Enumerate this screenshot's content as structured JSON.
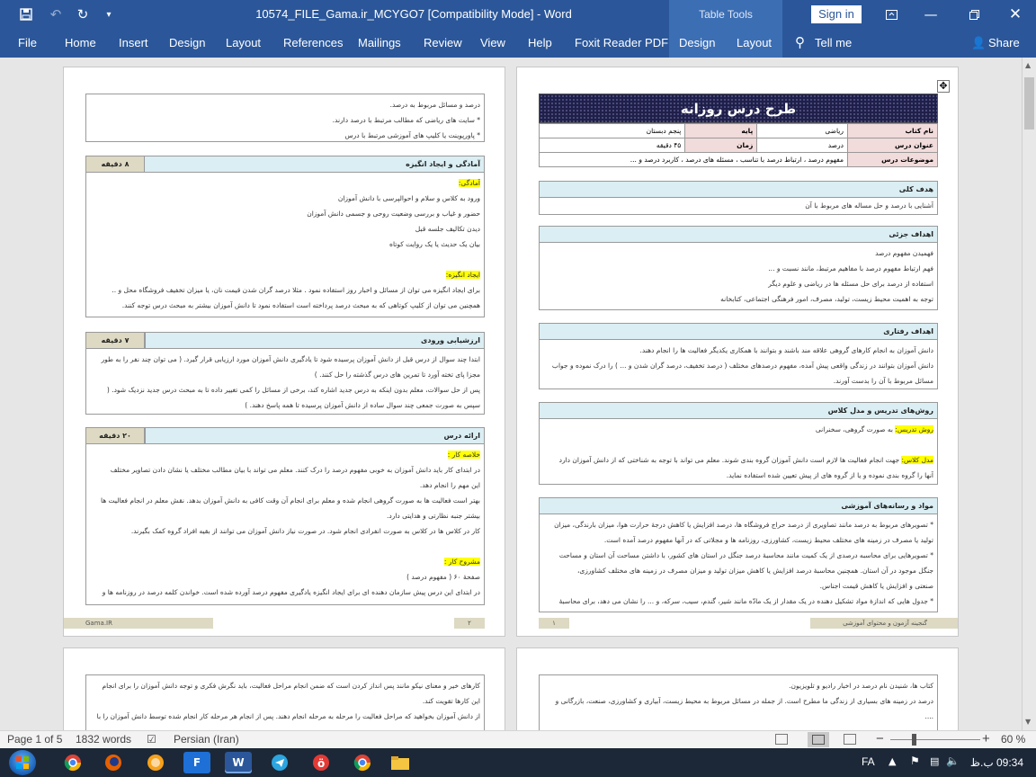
{
  "window": {
    "doc_title": "10574_FILE_Gama.ir_MCYGO7 [Compatibility Mode]  -  Word",
    "table_tools": "Table Tools",
    "sign_in": "Sign in",
    "share": "Share",
    "tell_me": "Tell me"
  },
  "ribbon": {
    "tabs": [
      "File",
      "Home",
      "Insert",
      "Design",
      "Layout",
      "References",
      "Mailings",
      "Review",
      "View",
      "Help",
      "Foxit Reader PDF",
      "Design",
      "Layout"
    ]
  },
  "page1": {
    "main_title": "طرح درس روزانه",
    "table": [
      [
        "نام کتاب",
        "ریاضی",
        "پایه",
        "پنجم دبستان"
      ],
      [
        "عنوان درس",
        "درصد",
        "زمان",
        "۴۵ دقیقه"
      ],
      [
        "موضوعات درس",
        "مفهوم درصد ، ارتباط درصد با تناسب ، مسئله های درصد ، کاربرد درصد و ..."
      ]
    ],
    "goal_h": "هدف کلی",
    "goal_lines": [
      "آشنایی با درصد و حل مساله های مربوط با آن"
    ],
    "partial_h": "اهداف جزئی",
    "partial_lines": [
      "فهمیدن مفهوم درصد",
      "فهم ارتباط مفهوم درصد با مفاهیم مرتبط، مانند نسبت و ...",
      "استفاده از درصد برای حل مسئله ها در ریاضی و علوم دیگر",
      "توجه به اهمیت محیط زیست، تولید، مصرف، امور فرهنگی اجتماعی، کتابخانه"
    ],
    "behav_h": "اهداف رفتاری",
    "behav_lines": [
      "دانش آموزان به انجام کارهای گروهی علاقه مند باشند و بتوانند با همکاری یکدیگر فعالیت ها را انجام دهند.",
      "دانش آموزان بتوانند در زندگی واقعی پیش آمده، مفهوم درصدهای مختلف ( درصد تخفیف، درصد گران شدن و ... ) را درک نموده و جواب",
      "مسائل مربوط با آن را بدست آورند."
    ],
    "method_h": "روش‌های تدریس و مدل کلاس",
    "method_hl1": "روش تدریس:",
    "method_l1": " به صورت گروهی، سخنرانی",
    "method_hl2": "مدل کلاس:",
    "method_l2": " جهت انجام فعالیت ها لازم است دانش آموزان گروه بندی شوند. معلم می تواند با توجه به شناختی که از دانش آموزان دارد",
    "method_l3": "آنها را گروه بندی نموده و یا از گروه های از پیش تعیین شده استفاده نماید.",
    "media_h": "مواد و رسانه‌های آموزشی",
    "media_lines": [
      "* تصویرهای مربوط به درصد مانند تصاویری از درصد حراج فروشگاه ها، درصد افزایش یا کاهش درجهٔ حرارت هوا، میزان بارندگی، میزان",
      "تولید یا مصرف در زمینه های مختلف محیط زیست، کشاورزی، روزنامه ها و مجلاتی که در آنها مفهوم درصد آمده است.",
      "* تصویرهایی برای محاسبه درصدی از یک کمیت مانند محاسبهٔ درصد جنگل در استان های کشور، با داشتن مساحت آن استان و مساحت",
      "جنگل موجود در آن استان. همچنین محاسبهٔ درصد افزایش یا کاهش میزان تولید و میزان مصرف در زمینه های مختلف کشاورزی،",
      "صنعتی و افزایش یا کاهش قیمت اجناس.",
      "* جدول هایی که اندازهٔ مواد تشکیل دهنده در یک مقدار از یک مادّه مانند شیر، گندم، سیب، سرکه، و ... را نشان می دهد، برای محاسبهٔ"
    ],
    "footer_left": "۱",
    "footer_right": "گنجینه آزمون و محتوای آموزشی"
  },
  "page2": {
    "top_lines": [
      "درصد و مسائل مربوط به درصد.",
      "* سایت های ریاضی که مطالب مرتبط با درصد دارند.",
      "* پاورپوینت یا کلیپ های آموزشی مرتبط با درس"
    ],
    "s1_h": "آمادگی و ایجاد انگیزه",
    "s1_t": "۸ دقیقه",
    "s1_hl1": "آمادگی:",
    "s1_lines": [
      "ورود به کلاس و سلام و احوالپرسی با دانش آموزان",
      "حضور و غیاب و بررسی وضعیت روحی و جسمی دانش آموزان",
      "دیدن تکالیف جلسه قبل",
      "بیان یک حدیث یا یک روایت کوتاه"
    ],
    "s1_hl2": "ایجاد انگیزه:",
    "s1_lines2": [
      "برای ایجاد انگیزه می توان از مسائل و اخبار روز استفاده نمود . مثلا درصد گران شدن قیمت نان، یا میزان تخفیف فروشگاه محل و ..",
      "همچنین می توان از کلیپ کوتاهی که به مبحث درصد پرداخته است استفاده نمود تا دانش آموزان بیشتر به مبحث درس توجه کنند."
    ],
    "s2_h": "ارزشیابی ورودی",
    "s2_t": "۷ دقیقه",
    "s2_lines": [
      "ابتدا چند سوال از درس قبل از دانش آموزان پرسیده شود تا یادگیری دانش آموزان مورد ارزیابی قرار گیرد. ( می توان چند نفر را به طور",
      "مجزا پای تخته آورد تا تمرین های درس گذشته را حل کنند. )",
      "پس از حل سوالات، معلم بدون اینکه به درس جدید اشاره کند، برخی از مسائل را کمی تغییر داده تا به مبحث درس جدید نزدیک شود. (",
      "سپس به صورت جمعی چند سوال ساده از دانش آموزان پرسیده تا همه پاسخ دهند. )"
    ],
    "s3_h": "ارائه درس",
    "s3_t": "۲۰ دقیقه",
    "s3_hl1": "خلاصه کار :",
    "s3_lines": [
      "در ابتدای کار باید دانش آموزان به خوبی مفهوم درصد را درک کنند. معلم می تواند با بیان مطالب مختلف یا نشان دادن تصاویر مختلف",
      "این مهم را انجام دهد.",
      "بهتر است فعالیت ها به صورت گروهی انجام شده و معلم برای انجام آن وقت کافی به دانش آموزان بدهد. نقش معلم در انجام فعالیت ها",
      "بیشتر جنبه نظارتی و هدایتی دارد.",
      "کار در کلاس ها در کلاس به صورت انفرادی انجام شود. در صورت نیاز دانش آموزان می توانند از بقیه افراد گروه کمک بگیرند."
    ],
    "s3_hl2": "مشروح کار :",
    "s3_lines2": [
      "صفحهٔ ۶۰ ( مفهوم درصد )",
      "در ابتدای این درس پیش سازمان دهنده ای برای ایجاد انگیزه یادگیری مفهوم درصد آورده شده است. خواندن کلمه درصد در روزنامه ها و"
    ],
    "footer_left": "Gama.IR",
    "footer_right": "۲"
  },
  "page3": {
    "lines": [
      "کتاب ها، شنیدن نام درصد در اخبار رادیو و تلویزیون.",
      "درصد در زمینه های بسیاری از زندگی ما مطرح است. از جمله در مسائل مربوط به محیط زیست، آبیاری و کشاورزی، صنعت، بازرگانی و",
      "...."
    ]
  },
  "page4": {
    "lines": [
      "کارهای خیر و معنای نیکو مانند پس انداز کردن است که ضمن انجام مراحل فعالیت، باید نگرش فکری و توجه دانش آموزان را برای انجام",
      "این کارها تقویت کند.",
      "از دانش آموزان بخواهید که مراحل فعالیت را مرحله به مرحله انجام دهند. پس از انجام هر مرحله کار انجام شده توسط دانش آموزان را با"
    ]
  },
  "status": {
    "page": "Page 1 of 5",
    "words": "1832 words",
    "language": "Persian (Iran)",
    "zoom": "60 %"
  },
  "taskbar": {
    "lang": "FA",
    "time": "09:34 ب.ظ"
  },
  "colors": {
    "word_blue": "#2b579a",
    "context_blue": "#3c6eb4",
    "section_blue": "#daeef3",
    "section_tan": "#ddd9c3",
    "label_pink": "#f2dbdb",
    "title_navy": "#1f1f4a",
    "highlight": "#ffff00"
  }
}
